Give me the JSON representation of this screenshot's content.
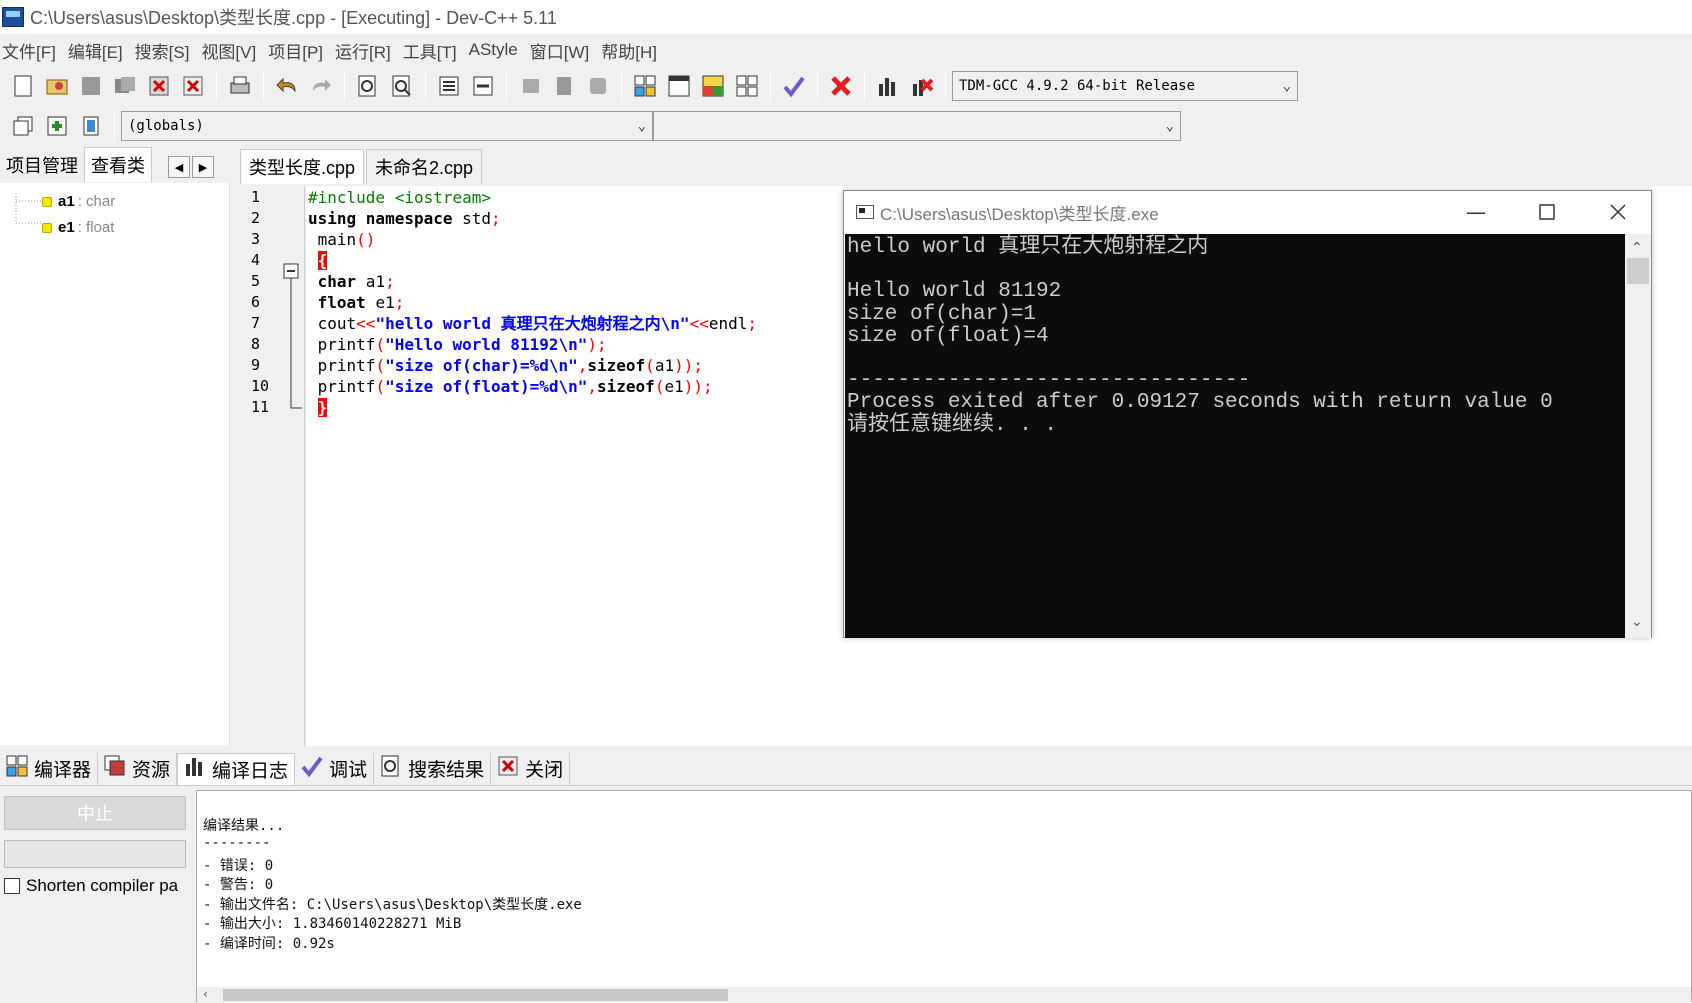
{
  "window": {
    "title": "C:\\Users\\asus\\Desktop\\类型长度.cpp - [Executing] - Dev-C++ 5.11"
  },
  "menu": [
    "文件[F]",
    "编辑[E]",
    "搜索[S]",
    "视图[V]",
    "项目[P]",
    "运行[R]",
    "工具[T]",
    "AStyle",
    "窗口[W]",
    "帮助[H]"
  ],
  "toolbar": {
    "compiler_select": "TDM-GCC 4.9.2 64-bit Release",
    "scope_select": "(globals)",
    "function_select": ""
  },
  "left_panel": {
    "tabs": [
      "项目管理",
      "查看类"
    ],
    "items": [
      {
        "name": "a1",
        "type": ": char"
      },
      {
        "name": "e1",
        "type": ": float"
      }
    ]
  },
  "editor": {
    "tabs": [
      "类型长度.cpp",
      "未命名2.cpp"
    ],
    "line_numbers": [
      "1",
      "2",
      "3",
      "4",
      "5",
      "6",
      "7",
      "8",
      "9",
      "10",
      "11"
    ],
    "lines": [
      {
        "segments": [
          {
            "c": "pp",
            "t": "#include <iostream>"
          }
        ]
      },
      {
        "segments": [
          {
            "c": "kw",
            "t": "using namespace"
          },
          {
            "c": "",
            "t": " std"
          },
          {
            "c": "sym",
            "t": ";"
          }
        ]
      },
      {
        "segments": [
          {
            "c": "",
            "t": " main"
          },
          {
            "c": "sym",
            "t": "()"
          }
        ]
      },
      {
        "segments": [
          {
            "c": "",
            "t": " "
          },
          {
            "c": "brace",
            "t": "{"
          }
        ]
      },
      {
        "segments": [
          {
            "c": "",
            "t": " "
          },
          {
            "c": "kw",
            "t": "char"
          },
          {
            "c": "",
            "t": " a1"
          },
          {
            "c": "sym",
            "t": ";"
          }
        ]
      },
      {
        "segments": [
          {
            "c": "",
            "t": " "
          },
          {
            "c": "kw",
            "t": "float"
          },
          {
            "c": "",
            "t": " e1"
          },
          {
            "c": "sym",
            "t": ";"
          }
        ]
      },
      {
        "segments": [
          {
            "c": "",
            "t": " cout"
          },
          {
            "c": "sym",
            "t": "<<"
          },
          {
            "c": "str",
            "t": "\"hello world 真理只在大炮射程之内\\n\""
          },
          {
            "c": "sym",
            "t": "<<"
          },
          {
            "c": "",
            "t": "endl"
          },
          {
            "c": "sym",
            "t": ";"
          }
        ]
      },
      {
        "segments": [
          {
            "c": "",
            "t": " printf"
          },
          {
            "c": "sym",
            "t": "("
          },
          {
            "c": "str",
            "t": "\"Hello world 81192\\n\""
          },
          {
            "c": "sym",
            "t": ");"
          }
        ]
      },
      {
        "segments": [
          {
            "c": "",
            "t": " printf"
          },
          {
            "c": "sym",
            "t": "("
          },
          {
            "c": "str",
            "t": "\"size of(char)=%d\\n\""
          },
          {
            "c": "sym",
            "t": ","
          },
          {
            "c": "kw",
            "t": "sizeof"
          },
          {
            "c": "sym",
            "t": "("
          },
          {
            "c": "",
            "t": "a1"
          },
          {
            "c": "sym",
            "t": "));"
          }
        ]
      },
      {
        "segments": [
          {
            "c": "",
            "t": " printf"
          },
          {
            "c": "sym",
            "t": "("
          },
          {
            "c": "str",
            "t": "\"size of(float)=%d\\n\""
          },
          {
            "c": "sym",
            "t": ","
          },
          {
            "c": "kw",
            "t": "sizeof"
          },
          {
            "c": "sym",
            "t": "("
          },
          {
            "c": "",
            "t": "e1"
          },
          {
            "c": "sym",
            "t": "));"
          }
        ]
      },
      {
        "segments": [
          {
            "c": "",
            "t": " "
          },
          {
            "c": "brace",
            "t": "}"
          }
        ]
      }
    ]
  },
  "console": {
    "title": "C:\\Users\\asus\\Desktop\\类型长度.exe",
    "lines": [
      "hello world 真理只在大炮射程之内",
      "",
      "Hello world 81192",
      "size of(char)=1",
      "size of(float)=4",
      "",
      "--------------------------------",
      "Process exited after 0.09127 seconds with return value 0",
      "请按任意键继续. . ."
    ]
  },
  "bottom": {
    "tabs": [
      "编译器",
      "资源",
      "编译日志",
      "调试",
      "搜索结果",
      "关闭"
    ],
    "stop_button": "中止",
    "shorten_label": "Shorten compiler pa",
    "log_lines": [
      "编译结果...",
      "--------",
      "- 错误: 0",
      "- 警告: 0",
      "- 输出文件名: C:\\Users\\asus\\Desktop\\类型长度.exe",
      "- 输出大小: 1.83460140228271 MiB",
      "- 编译时间: 0.92s"
    ]
  },
  "colors": {
    "current_line": "#ccffff",
    "console_bg": "#0c0c0c",
    "string": "#0000ff",
    "symbol": "#ff0000",
    "preprocessor": "#008000"
  }
}
